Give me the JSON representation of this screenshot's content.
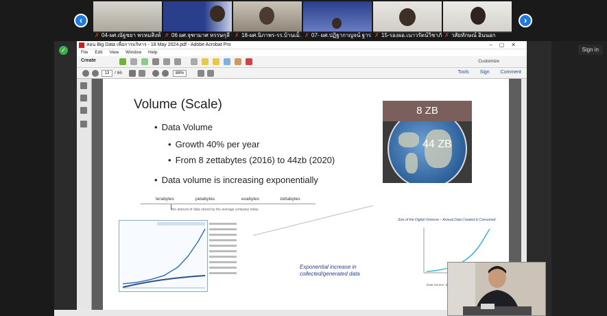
{
  "gallery": {
    "prev_arrow": "‹",
    "next_arrow": "›",
    "participants": [
      {
        "name": "04-ผศ.ณัฐชยา พรหมสิงห์"
      },
      {
        "name": "06 ผศ.จุฑามาศ หรรษกุลี ร..."
      },
      {
        "name": "18-ผศ.นิภาพร-รร.บ้านเม็..."
      },
      {
        "name": "07- ผศ.ปฏิฐากาญจน์ ฐาร..."
      },
      {
        "name": "15-รองผอ.เนาวรัตน์วิชาภัย..."
      },
      {
        "name": "วสัยทักษณ์ อินนอก"
      }
    ]
  },
  "window": {
    "title": "สอน Big Data เพื่อการบริหาร - 18 May 2024.pdf - Adobe Acrobat Pro",
    "menu": [
      "File",
      "Edit",
      "View",
      "Window",
      "Help"
    ],
    "create_label": "Create",
    "customize_label": "Customize",
    "page_current": "13",
    "page_total": "/ 66",
    "zoom": "88%",
    "links": [
      "Tools",
      "Sign",
      "Comment"
    ],
    "sign_in": "Sign in"
  },
  "slide": {
    "title": "Volume (Scale)",
    "bullets": [
      {
        "level": 1,
        "text": "Data Volume"
      },
      {
        "level": 2,
        "text": "Growth 40% per year"
      },
      {
        "level": 2,
        "text": "From 8 zettabytes (2016) to 44zb (2020)"
      },
      {
        "level": 1,
        "text": "Data volume is increasing exponentially"
      }
    ],
    "globe_small": "8 ZB",
    "globe_large": "44 ZB",
    "units": [
      "terabytes",
      "petabytes",
      "exabytes",
      "zettabytes"
    ],
    "units_caption": "the amount of data stored by the average company today",
    "exp_text_1": "Exponential increase in",
    "exp_text_2": "collected/generated data",
    "right_chart_title": "Size of the Digital Universe – Annual Data Created & Consumed",
    "data_source": "Data Source: IDC"
  },
  "colors": {
    "accent": "#1f7ae0",
    "acrobat_red": "#c7201f",
    "link_blue": "#1a4f9c"
  }
}
